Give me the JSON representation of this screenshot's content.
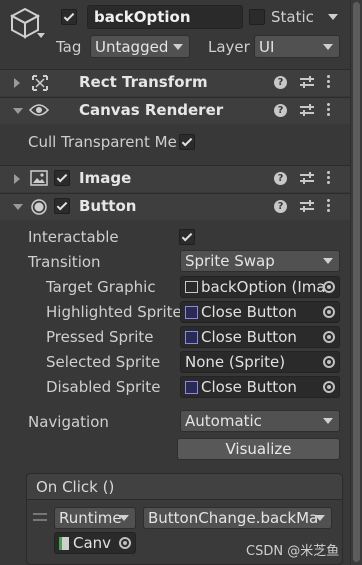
{
  "header": {
    "active": true,
    "name": "backOption",
    "static_label": "Static",
    "static_checked": false,
    "tag_label": "Tag",
    "tag_value": "Untagged",
    "layer_label": "Layer",
    "layer_value": "UI"
  },
  "components": {
    "rect_transform": {
      "title": "Rect Transform",
      "expanded": false
    },
    "canvas_renderer": {
      "title": "Canvas Renderer",
      "expanded": true,
      "cull_label": "Cull Transparent Mes",
      "cull_checked": true
    },
    "image": {
      "title": "Image",
      "expanded": false,
      "enabled": true
    },
    "button": {
      "title": "Button",
      "expanded": true,
      "enabled": true,
      "interactable_label": "Interactable",
      "interactable_checked": true,
      "transition_label": "Transition",
      "transition_value": "Sprite Swap",
      "target_graphic_label": "Target Graphic",
      "target_graphic_value": "backOption (Ima",
      "highlighted_label": "Highlighted Sprite",
      "highlighted_value": "Close Button",
      "pressed_label": "Pressed Sprite",
      "pressed_value": "Close Button",
      "selected_label": "Selected Sprite",
      "selected_value": "None (Sprite)",
      "disabled_label": "Disabled Sprite",
      "disabled_value": "Close Button",
      "navigation_label": "Navigation",
      "navigation_value": "Automatic",
      "visualize_label": "Visualize",
      "on_click_label": "On Click ()",
      "runtime_value": "Runtime",
      "function_value": "ButtonChange.backMa",
      "object_value": "Canv"
    }
  },
  "watermark": "CSDN @米芝鱼",
  "colors": {
    "background": "#383838",
    "header_bg": "#3e3e3e",
    "field_bg": "#2a2a2a",
    "dropdown_bg": "#515151",
    "text": "#d2d2d2"
  },
  "icons": {
    "gameobject": "cube-icon",
    "rect_transform": "rect-transform-icon",
    "canvas_renderer": "eye-icon",
    "image": "image-icon",
    "button": "button-icon",
    "help": "help-icon",
    "preset": "preset-icon",
    "more": "kebab-menu-icon",
    "picker": "object-picker-icon",
    "sprite": "sprite-icon"
  }
}
